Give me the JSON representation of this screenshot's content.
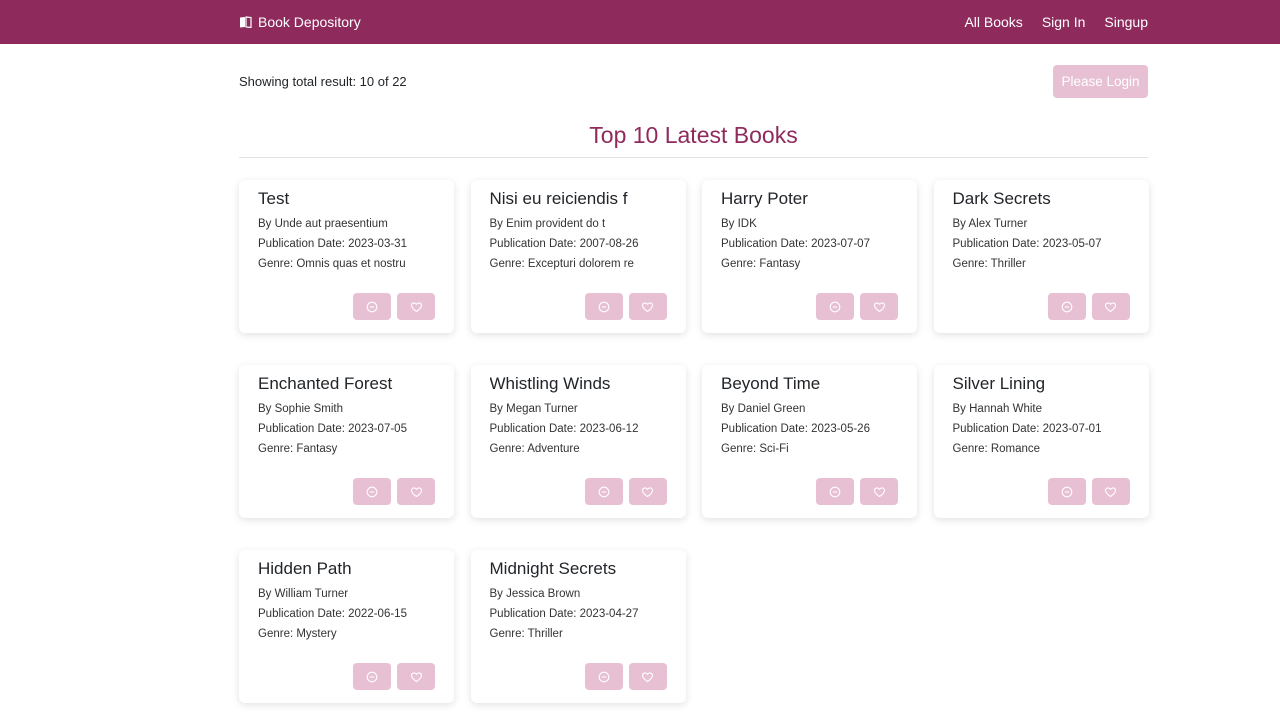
{
  "navbar": {
    "brand": "Book Depository",
    "links": [
      "All Books",
      "Sign In",
      "Singup"
    ]
  },
  "result": "Showing total result: 10 of 22",
  "login_button": "Please Login",
  "section_title": "Top 10 Latest Books",
  "books": [
    {
      "title": "Test",
      "author": "By Unde aut praesentium",
      "date": "Publication Date: 2023-03-31",
      "genre": "Genre: Omnis quas et nostru"
    },
    {
      "title": "Nisi eu reiciendis f",
      "author": "By Enim provident do t",
      "date": "Publication Date: 2007-08-26",
      "genre": "Genre: Excepturi dolorem re"
    },
    {
      "title": "Harry Poter",
      "author": "By IDK",
      "date": "Publication Date: 2023-07-07",
      "genre": "Genre: Fantasy"
    },
    {
      "title": "Dark Secrets",
      "author": "By Alex Turner",
      "date": "Publication Date: 2023-05-07",
      "genre": "Genre: Thriller"
    },
    {
      "title": "Enchanted Forest",
      "author": "By Sophie Smith",
      "date": "Publication Date: 2023-07-05",
      "genre": "Genre: Fantasy"
    },
    {
      "title": "Whistling Winds",
      "author": "By Megan Turner",
      "date": "Publication Date: 2023-06-12",
      "genre": "Genre: Adventure"
    },
    {
      "title": "Beyond Time",
      "author": "By Daniel Green",
      "date": "Publication Date: 2023-05-26",
      "genre": "Genre: Sci-Fi"
    },
    {
      "title": "Silver Lining",
      "author": "By Hannah White",
      "date": "Publication Date: 2023-07-01",
      "genre": "Genre: Romance"
    },
    {
      "title": "Hidden Path",
      "author": "By William Turner",
      "date": "Publication Date: 2022-06-15",
      "genre": "Genre: Mystery"
    },
    {
      "title": "Midnight Secrets",
      "author": "By Jessica Brown",
      "date": "Publication Date: 2023-04-27",
      "genre": "Genre: Thriller"
    }
  ],
  "icons": {
    "brand": "book-icon",
    "action_1": "circle-dash-icon",
    "action_2": "heart-icon"
  },
  "colors": {
    "primary": "#8e2a5c",
    "button_disabled": "#e7c0d3"
  }
}
